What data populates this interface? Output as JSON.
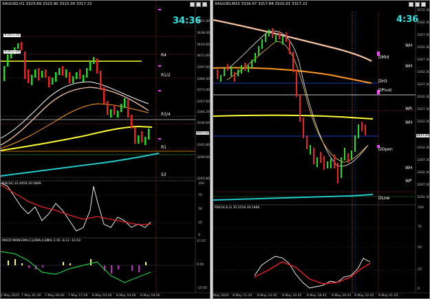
{
  "left": {
    "title": "XAUUSD,H1  3323.69 3323.90 3315.00 3317.22",
    "timer": "34:36",
    "levels": {
      "r4": "R4",
      "r1_2": "R1/2",
      "r3_4": "R3/4",
      "r1": "R1",
      "s3": "S3"
    },
    "price_axis": [
      "3451.40",
      "3438.00",
      "3424.60",
      "3411.00",
      "3397.60",
      "3384.40",
      "3371.00",
      "3357.60",
      "3344.20",
      "3330.60",
      "3317.22",
      "3303.80",
      "3290.60",
      "3263.80"
    ],
    "rsi_axis": [
      "100",
      "75",
      "50",
      "25",
      "0"
    ],
    "rsi_label": "RSI(14) 22.4459 20.5809",
    "macd_axis": [
      "17.07",
      "0.00",
      "-15.65"
    ],
    "macd_label": "MACD MAIN EMA,13,EMA,4,SMA) 2.91 -8.12 -12.03",
    "time_axis": [
      "2 May 2025",
      "7 May 01:00",
      "7 May 09:00",
      "7 May 17:00",
      "8 May 02:00",
      "8 May 10:00",
      "8 May 18:00"
    ],
    "tags": [
      "#3451.00",
      "#3417.00"
    ]
  },
  "right": {
    "title": "XAUUSD,M15  3316.97 3317.84 3315.01 3317.22",
    "timer": "4:36",
    "levels": {
      "dmid": "DMid",
      "dh3": "DH3",
      "dpivot": "DPivot",
      "wr": "WR",
      "dopen": "DOpen",
      "dlow": "DLow",
      "wh": "WH",
      "wh2": "WH",
      "wh3": "WH",
      "wh4": "WH",
      "wp": "WP"
    },
    "price_axis": [
      "3372.30",
      "3362.30",
      "3357.30",
      "3352.30",
      "3347.30",
      "3342.30",
      "3337.30",
      "3332.30",
      "3327.30",
      "3322.30",
      "3317.22",
      "3312.30",
      "3307.30",
      "3302.30",
      "3297.30",
      "3292.30"
    ],
    "rsi_axis": [
      "100",
      "75",
      "50",
      "25",
      "0"
    ],
    "rsi_label": "RSI(14,6,3) 35.2519 34.1466",
    "time_axis": [
      "May 2025",
      "8 May 11:45",
      "8 May 14:45",
      "8 May 16:45",
      "8 May 18:45",
      "8 May 20:45",
      "8 May 22:45",
      "9 May 01:45"
    ]
  },
  "colors": {
    "up_candle": "#22dd22",
    "down_candle": "#ee2222",
    "ma_yellow": "#ffff33",
    "ma_orange": "#ff9922",
    "ma_white": "#f5f5f5",
    "ma_cyan": "#22cccc",
    "ma_salmon": "#f7c4a3",
    "timer": "#2ee6e6"
  }
}
